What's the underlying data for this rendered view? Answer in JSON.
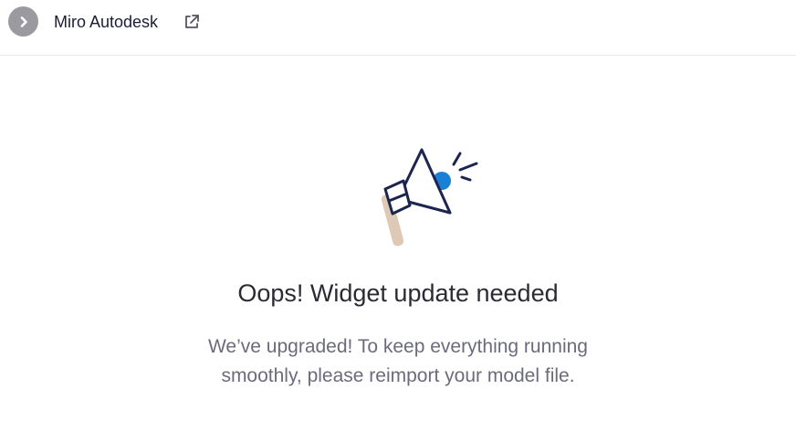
{
  "header": {
    "title": "Miro Autodesk",
    "collapse_icon": "chevron-right-icon",
    "link_icon": "external-link-icon"
  },
  "illustration": {
    "icon": "megaphone-icon",
    "colors": {
      "outline": "#1c2550",
      "accent": "#1a7fd6",
      "handle": "#ddc9b6"
    }
  },
  "content": {
    "heading": "Oops! Widget update needed",
    "message": "We’ve upgraded! To keep everything running smoothly, please reimport your model file."
  }
}
